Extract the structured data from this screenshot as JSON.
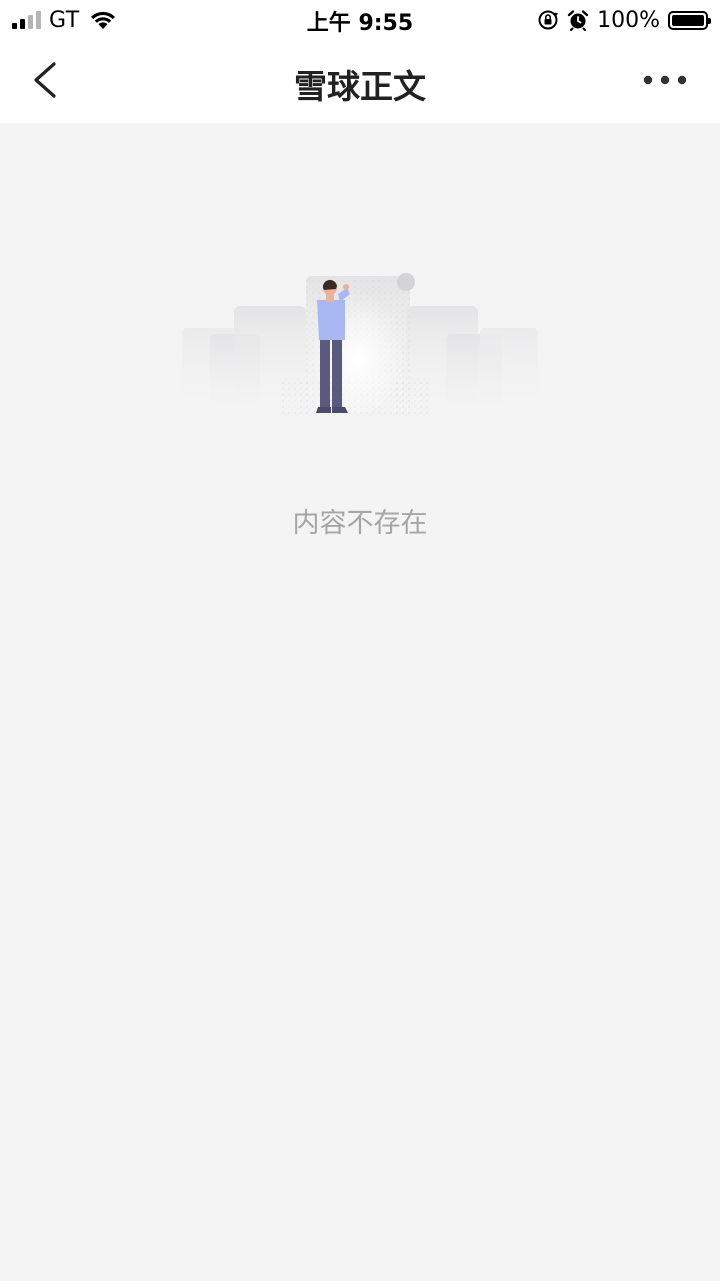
{
  "status_bar": {
    "carrier": "GT",
    "time": "上午 9:55",
    "battery_percent": "100%",
    "icons": [
      "signal-icon",
      "wifi-icon",
      "orientation-lock-icon",
      "alarm-icon",
      "battery-icon"
    ]
  },
  "nav": {
    "title": "雪球正文",
    "back_icon": "chevron-left-icon",
    "more_icon": "more-dots-icon"
  },
  "empty_state": {
    "message": "内容不存在",
    "illustration": "person-looking-at-scroll"
  },
  "colors": {
    "background": "#f4f4f4",
    "bar_background": "#ffffff",
    "message_text": "#a6a6a6",
    "person_shirt": "#a9b8f2",
    "person_pants": "#5a5a80"
  }
}
